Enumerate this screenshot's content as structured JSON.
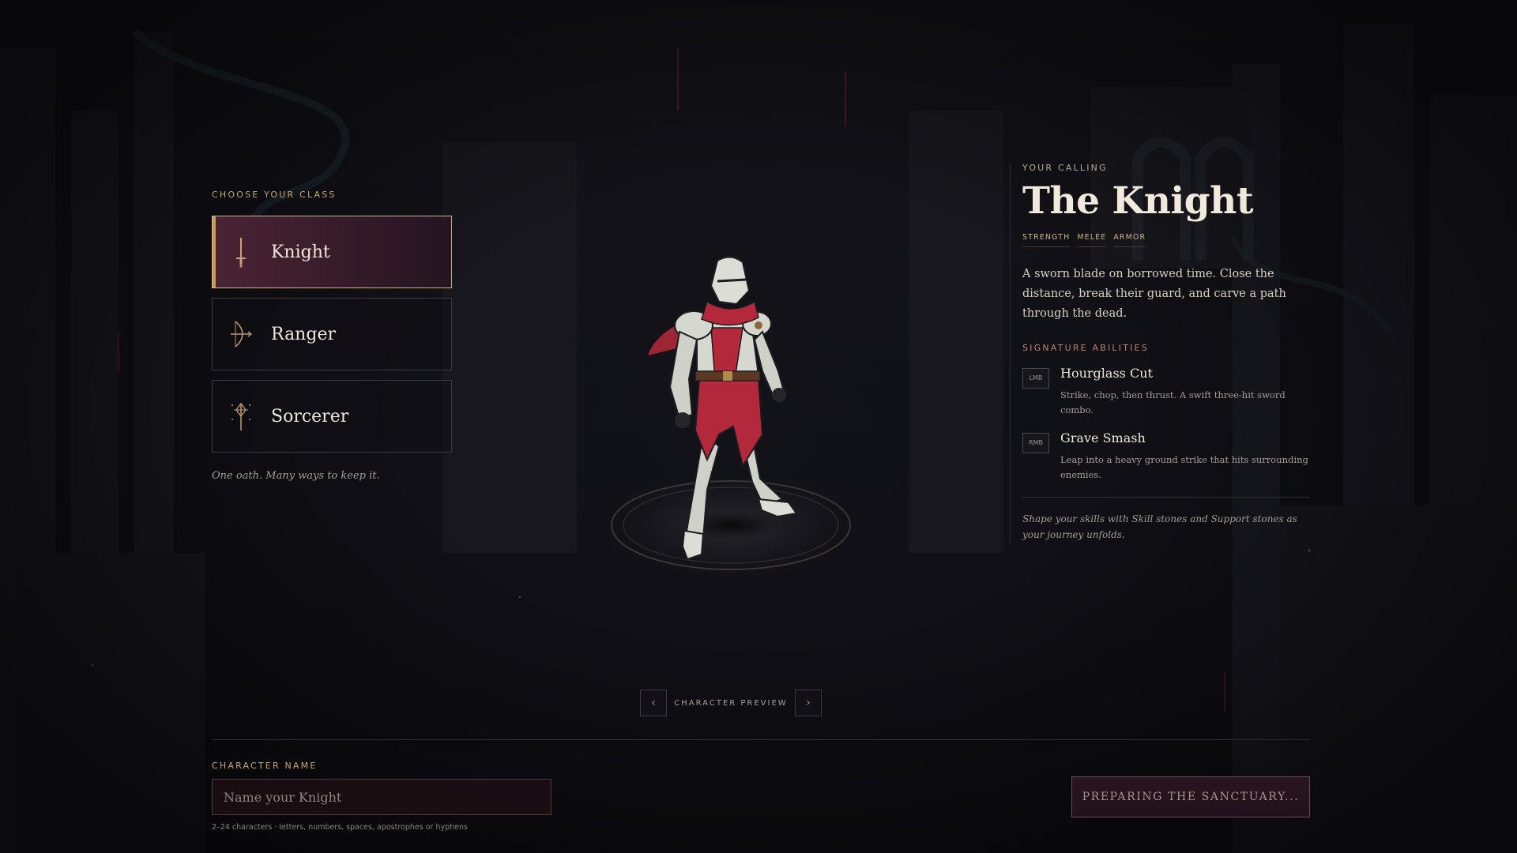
{
  "class_select": {
    "heading": "CHOOSE YOUR CLASS",
    "classes": [
      {
        "label": "Knight",
        "icon": "sword-icon",
        "selected": true
      },
      {
        "label": "Ranger",
        "icon": "bow-icon",
        "selected": false
      },
      {
        "label": "Sorcerer",
        "icon": "staff-icon",
        "selected": false
      }
    ],
    "tagline": "One oath. Many ways to keep it."
  },
  "preview": {
    "label": "CHARACTER PREVIEW",
    "prev_icon": "chevron-left-icon",
    "next_icon": "chevron-right-icon",
    "prev_glyph": "‹",
    "next_glyph": "›"
  },
  "details": {
    "eyebrow": "YOUR CALLING",
    "title": "The Knight",
    "tags": [
      "STRENGTH",
      "MELEE",
      "ARMOR"
    ],
    "description": "A sworn blade on borrowed time. Close the distance, break their guard, and carve a path through the dead.",
    "abilities_heading": "SIGNATURE ABILITIES",
    "abilities": [
      {
        "key": "LMB",
        "name": "Hourglass Cut",
        "desc": "Strike, chop, then thrust. A swift three-hit sword combo."
      },
      {
        "key": "RMB",
        "name": "Grave Smash",
        "desc": "Leap into a heavy ground strike that hits surrounding enemies."
      }
    ],
    "footnote": "Shape your skills with Skill stones and Support stones as your journey unfolds."
  },
  "name_entry": {
    "label": "CHARACTER NAME",
    "placeholder": "Name your Knight",
    "value": "",
    "hint": "2–24 characters · letters, numbers, spaces, apostrophes or hyphens"
  },
  "cta": {
    "label": "PREPARING THE SANCTUARY..."
  },
  "colors": {
    "accent_gold": "#c8a56e",
    "selected_bg": "#4a2434",
    "cloak_red": "#b3283a",
    "background": "#121117"
  }
}
